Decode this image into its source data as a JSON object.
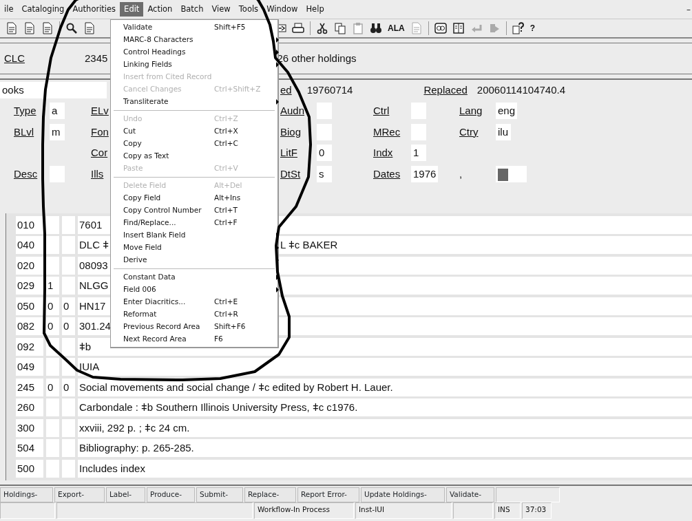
{
  "menubar": {
    "items": [
      {
        "label": "ile",
        "selected": false
      },
      {
        "label": "Cataloging",
        "selected": false
      },
      {
        "label": "Authorities",
        "selected": false
      },
      {
        "label": "Edit",
        "selected": true
      },
      {
        "label": "Action",
        "selected": false
      },
      {
        "label": "Batch",
        "selected": false
      },
      {
        "label": "View",
        "selected": false
      },
      {
        "label": "Tools",
        "selected": false
      },
      {
        "label": "Window",
        "selected": false
      },
      {
        "label": "Help",
        "selected": false
      }
    ],
    "window_control": "–"
  },
  "toolbar": {
    "text_buttons": [
      "ALA",
      "?"
    ]
  },
  "edit_menu": [
    {
      "kind": "item",
      "label": "Validate",
      "shortcut": "Shift+F5",
      "disabled": false,
      "submenu": false
    },
    {
      "kind": "item",
      "label": "MARC-8 Characters",
      "disabled": false,
      "submenu": true
    },
    {
      "kind": "item",
      "label": "Control Headings",
      "disabled": false,
      "submenu": true
    },
    {
      "kind": "item",
      "label": "Linking Fields",
      "disabled": false,
      "submenu": true
    },
    {
      "kind": "item",
      "label": "Insert from Cited Record",
      "disabled": true,
      "submenu": false
    },
    {
      "kind": "item",
      "label": "Cancel Changes",
      "shortcut": "Ctrl+Shift+Z",
      "disabled": true,
      "submenu": false
    },
    {
      "kind": "item",
      "label": "Transliterate",
      "disabled": false,
      "submenu": true
    },
    {
      "kind": "separator"
    },
    {
      "kind": "item",
      "label": "Undo",
      "shortcut": "Ctrl+Z",
      "disabled": true,
      "submenu": false
    },
    {
      "kind": "item",
      "label": "Cut",
      "shortcut": "Ctrl+X",
      "disabled": false,
      "submenu": false
    },
    {
      "kind": "item",
      "label": "Copy",
      "shortcut": "Ctrl+C",
      "disabled": false,
      "submenu": false
    },
    {
      "kind": "item",
      "label": "Copy as Text",
      "disabled": false,
      "submenu": false
    },
    {
      "kind": "item",
      "label": "Paste",
      "shortcut": "Ctrl+V",
      "disabled": true,
      "submenu": false
    },
    {
      "kind": "separator"
    },
    {
      "kind": "item",
      "label": "Delete Field",
      "shortcut": "Alt+Del",
      "disabled": true,
      "submenu": false
    },
    {
      "kind": "item",
      "label": "Copy Field",
      "shortcut": "Alt+Ins",
      "disabled": false,
      "submenu": false
    },
    {
      "kind": "item",
      "label": "Copy Control Number",
      "shortcut": "Ctrl+T",
      "disabled": false,
      "submenu": false
    },
    {
      "kind": "item",
      "label": "Find/Replace...",
      "shortcut": "Ctrl+F",
      "disabled": false,
      "submenu": false
    },
    {
      "kind": "item",
      "label": "Insert Blank Field",
      "disabled": false,
      "submenu": true
    },
    {
      "kind": "item",
      "label": "Move Field",
      "disabled": false,
      "submenu": true
    },
    {
      "kind": "item",
      "label": "Derive",
      "disabled": false,
      "submenu": true
    },
    {
      "kind": "separator"
    },
    {
      "kind": "item",
      "label": "Constant Data",
      "disabled": false,
      "submenu": true
    },
    {
      "kind": "item",
      "label": "Field 006",
      "disabled": false,
      "submenu": true
    },
    {
      "kind": "item",
      "label": "Enter Diacritics...",
      "shortcut": "Ctrl+E",
      "disabled": false,
      "submenu": false
    },
    {
      "kind": "item",
      "label": "Reformat",
      "shortcut": "Ctrl+R",
      "disabled": false,
      "submenu": false
    },
    {
      "kind": "item",
      "label": "Previous Record Area",
      "shortcut": "Shift+F6",
      "disabled": false,
      "submenu": false
    },
    {
      "kind": "item",
      "label": "Next Record Area",
      "shortcut": "F6",
      "disabled": false,
      "submenu": false
    }
  ],
  "holdings_row": {
    "label": "CLC",
    "number": "2345",
    "holdings": "26 other holdings"
  },
  "record_row": {
    "format": "ooks",
    "entered_label": "ed",
    "entered": "19760714",
    "replaced_label": "Replaced",
    "replaced": "20060114104740.4"
  },
  "fixed_fields": [
    [
      {
        "kind": "field",
        "label": "Type",
        "value": "a"
      },
      {
        "kind": "field",
        "label": "ELv"
      },
      {
        "kind": "field",
        "label": "Audn"
      },
      {
        "kind": "field",
        "label": "Ctrl"
      },
      {
        "kind": "field",
        "label": "Lang",
        "value": "eng"
      }
    ],
    [
      {
        "kind": "field",
        "label": "BLvl",
        "value": "m"
      },
      {
        "kind": "field",
        "label": "Fon"
      },
      {
        "kind": "field",
        "label": "Biog"
      },
      {
        "kind": "field",
        "label": "MRec"
      },
      {
        "kind": "field",
        "label": "Ctry",
        "value": "ilu"
      }
    ],
    [
      {
        "kind": "blank"
      },
      {
        "kind": "field",
        "label": "Cor"
      },
      {
        "kind": "field",
        "label": "LitF",
        "value": "0"
      },
      {
        "kind": "field",
        "label": "Indx",
        "value": "1"
      },
      {
        "kind": "blank"
      }
    ],
    [
      {
        "kind": "field",
        "label": "Desc"
      },
      {
        "kind": "field",
        "label": "Ills"
      },
      {
        "kind": "field",
        "label": "DtSt",
        "value": "s"
      },
      {
        "kind": "field",
        "label": "Dates",
        "value": "1976"
      },
      {
        "kind": "separator",
        "label": ",",
        "cursor": true
      }
    ]
  ],
  "variable_fields": [
    {
      "tag": "010",
      "value": "7601"
    },
    {
      "tag": "040",
      "value": "DLC ǂ",
      "value_right": "L ǂc BAKER"
    },
    {
      "tag": "020",
      "value": "08093"
    },
    {
      "tag": "029",
      "ind1": "1",
      "value": "NLGG"
    },
    {
      "tag": "050",
      "ind1": "0",
      "ind2": "0",
      "value": "HN17"
    },
    {
      "tag": "082",
      "ind1": "0",
      "ind2": "0",
      "value": "301.24"
    },
    {
      "tag": "092",
      "value": "ǂb"
    },
    {
      "tag": "049",
      "value": "IUIA"
    },
    {
      "tag": "245",
      "ind1": "0",
      "ind2": "0",
      "value": "Social movements and social change / ǂc edited by Robert H. Lauer."
    },
    {
      "tag": "260",
      "value": "Carbondale : ǂb Southern Illinois University Press, ǂc c1976."
    },
    {
      "tag": "300",
      "value": "xxviii, 292 p. ; ǂc 24 cm."
    },
    {
      "tag": "504",
      "value": "Bibliography: p. 265-285."
    },
    {
      "tag": "500",
      "value": "Includes index"
    }
  ],
  "action_bar": [
    {
      "kind": "button",
      "label": "Holdings-"
    },
    {
      "kind": "button",
      "label": "Export-"
    },
    {
      "kind": "button",
      "label": "Label-"
    },
    {
      "kind": "button",
      "label": "Produce-"
    },
    {
      "kind": "button",
      "label": "Submit-"
    },
    {
      "kind": "button",
      "label": "Replace-"
    },
    {
      "kind": "button",
      "label": "Report Error-"
    },
    {
      "kind": "button",
      "label": "Update Holdings-"
    },
    {
      "kind": "button",
      "label": "Validate-"
    },
    {
      "kind": "blank"
    }
  ],
  "status_bar": [
    {
      "kind": "blank"
    },
    {
      "kind": "blank"
    },
    {
      "kind": "pane",
      "text": "Workflow-In Process"
    },
    {
      "kind": "pane",
      "text": "Inst-IUI"
    },
    {
      "kind": "blank"
    },
    {
      "kind": "pane",
      "text": "INS"
    },
    {
      "kind": "pane",
      "text": "37:03"
    }
  ]
}
